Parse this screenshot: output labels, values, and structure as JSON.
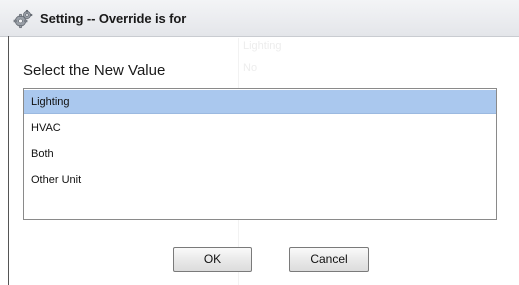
{
  "dialog": {
    "title": "Setting -- Override is for",
    "title_icon": "gears-icon",
    "prompt": "Select the New Value"
  },
  "background_text": {
    "line1": "Lighting",
    "line2": "No"
  },
  "options": [
    {
      "label": "Lighting",
      "selected": true
    },
    {
      "label": "HVAC",
      "selected": false
    },
    {
      "label": "Both",
      "selected": false
    },
    {
      "label": "Other Unit",
      "selected": false
    }
  ],
  "buttons": {
    "ok_label": "OK",
    "cancel_label": "Cancel"
  },
  "colors": {
    "selection": "#aac8ee",
    "title_bar": "#e8eaed",
    "border": "#8a8a8a"
  }
}
